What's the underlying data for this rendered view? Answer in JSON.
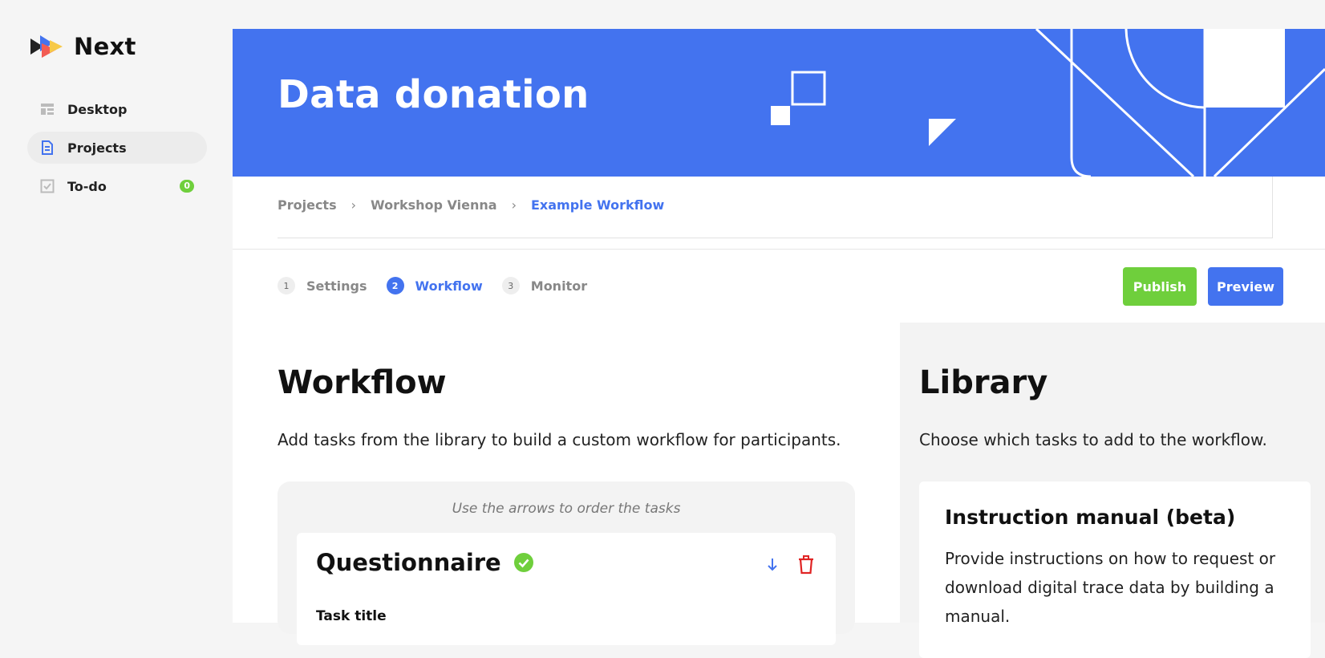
{
  "app": {
    "name": "Next"
  },
  "sidebar": {
    "items": [
      {
        "label": "Desktop",
        "icon": "desktop-icon"
      },
      {
        "label": "Projects",
        "icon": "projects-icon",
        "active": true
      },
      {
        "label": "To-do",
        "icon": "todo-icon",
        "badge": "0"
      }
    ]
  },
  "banner": {
    "title": "Data donation"
  },
  "breadcrumb": {
    "items": [
      "Projects",
      "Workshop Vienna"
    ],
    "current": "Example Workflow"
  },
  "steps": [
    {
      "num": "1",
      "label": "Settings"
    },
    {
      "num": "2",
      "label": "Workflow",
      "active": true
    },
    {
      "num": "3",
      "label": "Monitor"
    }
  ],
  "actions": {
    "publish": "Publish",
    "preview": "Preview"
  },
  "workflow": {
    "title": "Workflow",
    "description": "Add tasks from the library to build a custom workflow for participants.",
    "hint": "Use the arrows to order the tasks",
    "task": {
      "name": "Questionnaire",
      "field_label": "Task title"
    }
  },
  "library": {
    "title": "Library",
    "description": "Choose which tasks to add to the workflow.",
    "card": {
      "title": "Instruction manual (beta)",
      "text": "Provide instructions on how to request or download digital trace data by building a manual."
    }
  },
  "colors": {
    "primary": "#4373ef",
    "success": "#6fcf3c",
    "danger": "#e02424"
  }
}
